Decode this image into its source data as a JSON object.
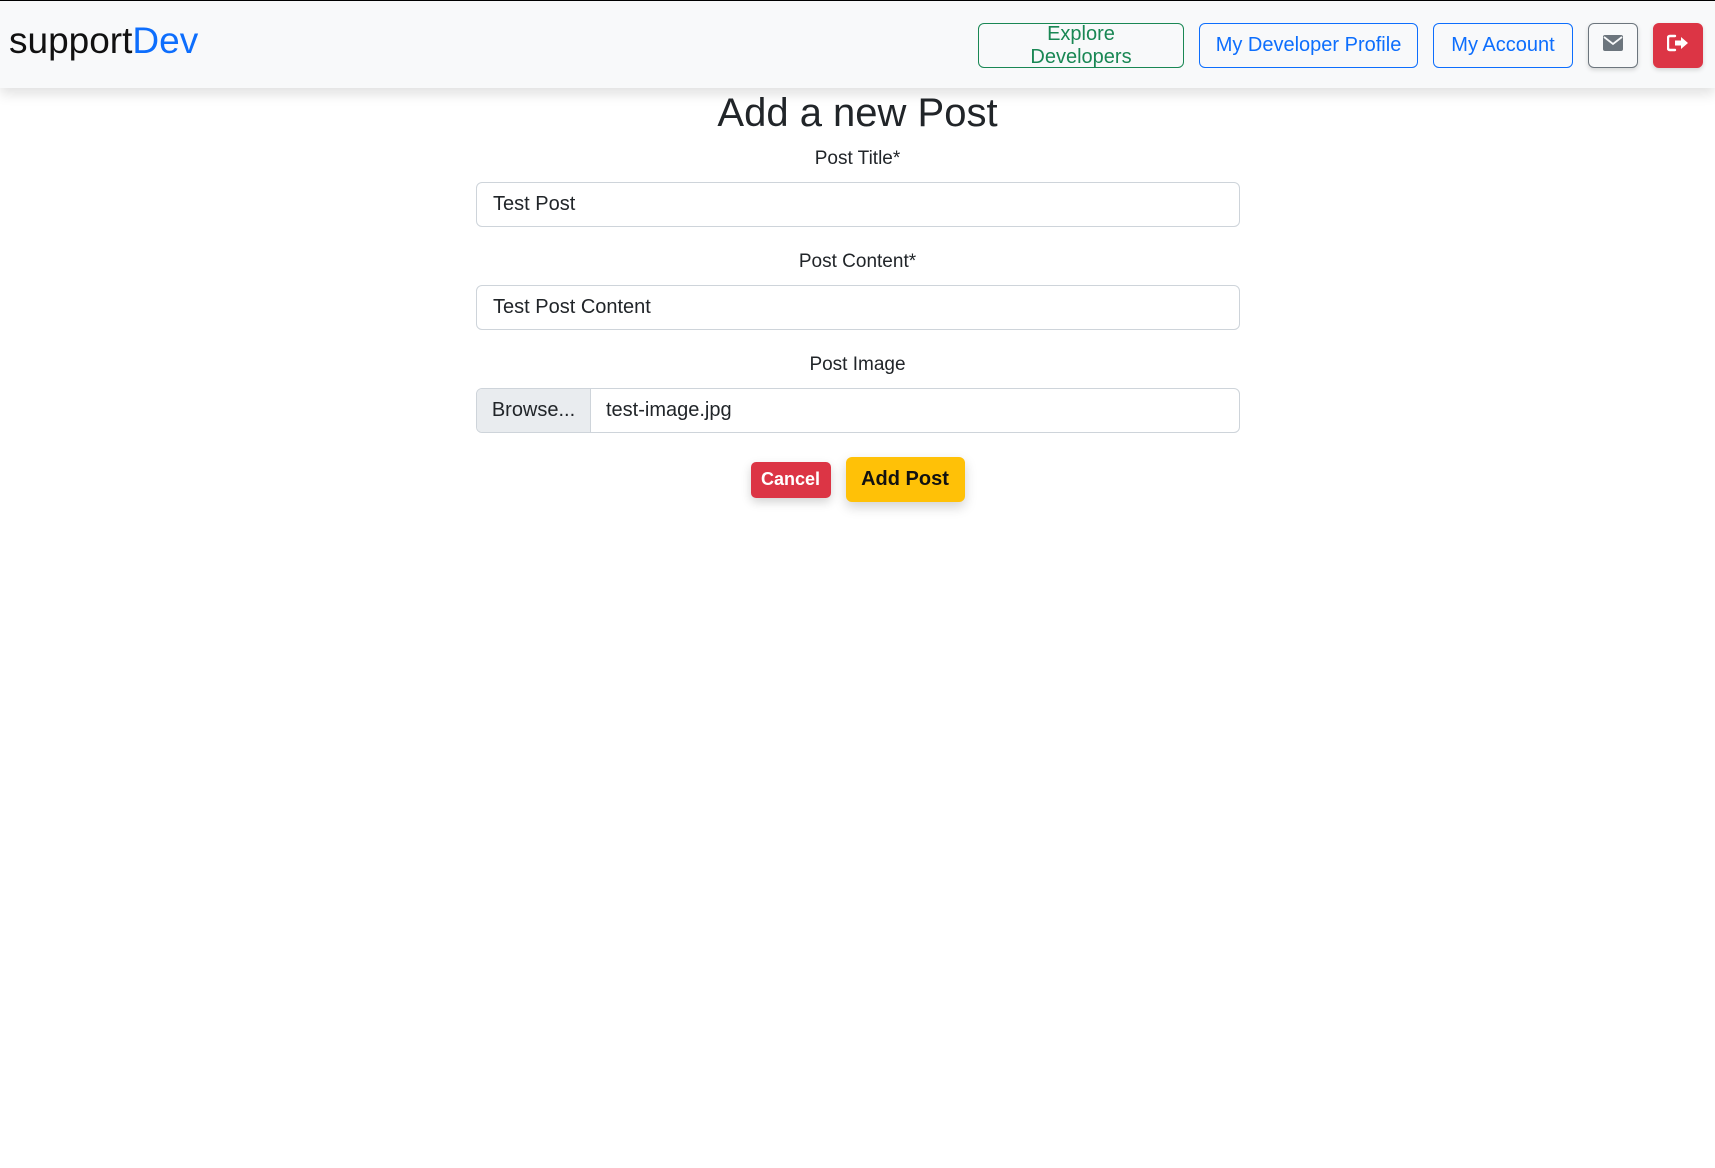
{
  "navbar": {
    "brand_prefix": "support",
    "brand_accent": "Dev",
    "buttons": {
      "explore": "Explore Developers",
      "profile": "My Developer Profile",
      "account": "My Account"
    },
    "icons": [
      "envelope-icon",
      "sign-out-icon"
    ]
  },
  "form": {
    "title": "Add a new Post",
    "post_title_label": "Post Title*",
    "post_title_value": "Test Post",
    "post_content_label": "Post Content*",
    "post_content_value": "Test Post Content",
    "post_image_label": "Post Image",
    "browse_label": "Browse...",
    "file_name": "test-image.jpg",
    "cancel_label": "Cancel",
    "submit_label": "Add Post"
  },
  "colors": {
    "primary": "#0d6efd",
    "success": "#198754",
    "danger": "#dc3545",
    "warning": "#ffc107"
  }
}
